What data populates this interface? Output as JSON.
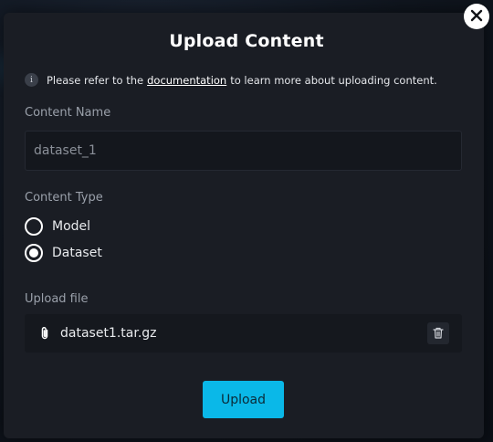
{
  "modal": {
    "title": "Upload Content",
    "close_icon": "close-icon"
  },
  "info": {
    "icon": "info-icon",
    "text_before": "Please refer to the",
    "link_text": "documentation",
    "text_after": "to learn more about uploading content."
  },
  "content_name": {
    "label": "Content Name",
    "value": "dataset_1"
  },
  "content_type": {
    "label": "Content Type",
    "options": [
      {
        "label": "Model",
        "selected": false
      },
      {
        "label": "Dataset",
        "selected": true
      }
    ]
  },
  "upload_file": {
    "label": "Upload file",
    "file_name": "dataset1.tar.gz",
    "attach_icon": "paperclip-icon",
    "delete_icon": "trash-icon"
  },
  "actions": {
    "upload_label": "Upload"
  },
  "colors": {
    "accent": "#0ab8e8",
    "modal_bg": "#1a1d24",
    "input_bg": "#14171d"
  }
}
